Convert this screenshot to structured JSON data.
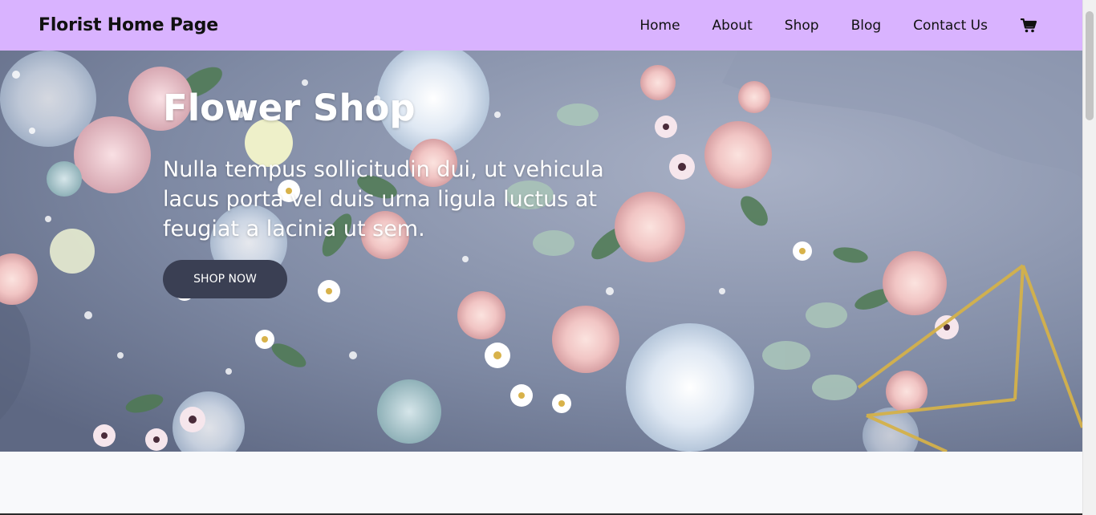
{
  "navbar": {
    "brand": "Florist Home Page",
    "links": [
      "Home",
      "About",
      "Shop",
      "Blog",
      "Contact Us"
    ],
    "cart_icon": "shopping-cart-icon"
  },
  "hero": {
    "title": "Flower Shop",
    "text": "Nulla tempus sollicitudin dui, ut vehicula lacus porta vel duis urna ligula luctus at feugiat a lacinia ut sem.",
    "button_label": "SHOP NOW"
  },
  "colors": {
    "navbar_bg": "#d9b3ff",
    "button_bg": "#3a3f53",
    "page_bg": "#f8f9fb"
  }
}
